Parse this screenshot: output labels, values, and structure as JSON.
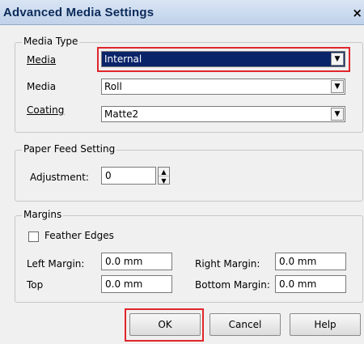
{
  "window": {
    "title": "Advanced Media Settings",
    "close_glyph": "×"
  },
  "media_type": {
    "legend": "Media Type",
    "media_label": "Media",
    "media_value": "Internal",
    "media2_label": "Media",
    "media2_value": "Roll",
    "coating_label": "Coating",
    "coating_value": "Matte2"
  },
  "paper_feed": {
    "legend": "Paper Feed Setting",
    "adjustment_label": "Adjustment:",
    "adjustment_value": "0"
  },
  "margins": {
    "legend": "Margins",
    "feather_label": "Feather Edges",
    "left_label": "Left Margin:",
    "left_value": "0.0 mm",
    "right_label": "Right Margin:",
    "right_value": "0.0 mm",
    "top_label": "Top",
    "top_value": "0.0 mm",
    "bottom_label": "Bottom Margin:",
    "bottom_value": "0.0 mm"
  },
  "buttons": {
    "ok": "OK",
    "cancel": "Cancel",
    "help": "Help"
  },
  "colors": {
    "highlight_border": "#e0262b",
    "selection_bg": "#0a246a"
  }
}
